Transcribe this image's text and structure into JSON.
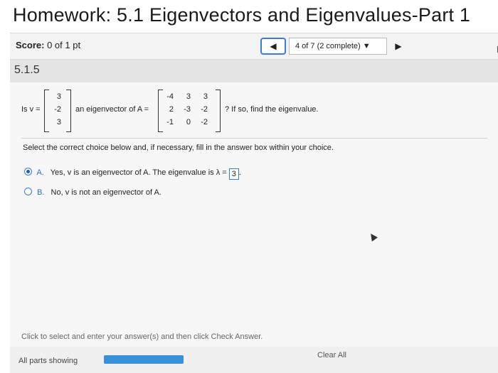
{
  "header": {
    "title": "Homework: 5.1 Eigenvectors and Eigenvalues-Part 1",
    "score_label": "Score:",
    "score_value": "0 of 1 pt",
    "nav_prev": "◀",
    "progress": "4 of 7 (2 complete) ▼",
    "nav_next": "▶",
    "edge_letter": "H"
  },
  "section": {
    "number": "5.1.5"
  },
  "problem": {
    "prefix": "Is v =",
    "vector": [
      "3",
      "-2",
      "3"
    ],
    "middle": "an eigenvector of A =",
    "matrix": [
      [
        "-4",
        "3",
        "3"
      ],
      [
        "2",
        "-3",
        "-2"
      ],
      [
        "-1",
        "0",
        "-2"
      ]
    ],
    "suffix": "? If so, find the eigenvalue."
  },
  "instruction": "Select the correct choice below and, if necessary, fill in the answer box within your choice.",
  "choices": [
    {
      "letter": "A.",
      "text": "Yes, v is an eigenvector of A. The eigenvalue is λ =",
      "answer": "3",
      "end": ".",
      "selected": true
    },
    {
      "letter": "B.",
      "text": "No, v is not an eigenvector of A.",
      "selected": false
    }
  ],
  "footer": {
    "hint": "Click to select and enter your answer(s) and then click Check Answer.",
    "parts_label": "All parts showing",
    "parts_progress": 1.0,
    "clear_all": "Clear All"
  },
  "colors": {
    "accent": "#3b7bd4",
    "progress_fill": "#3a8fd9"
  }
}
